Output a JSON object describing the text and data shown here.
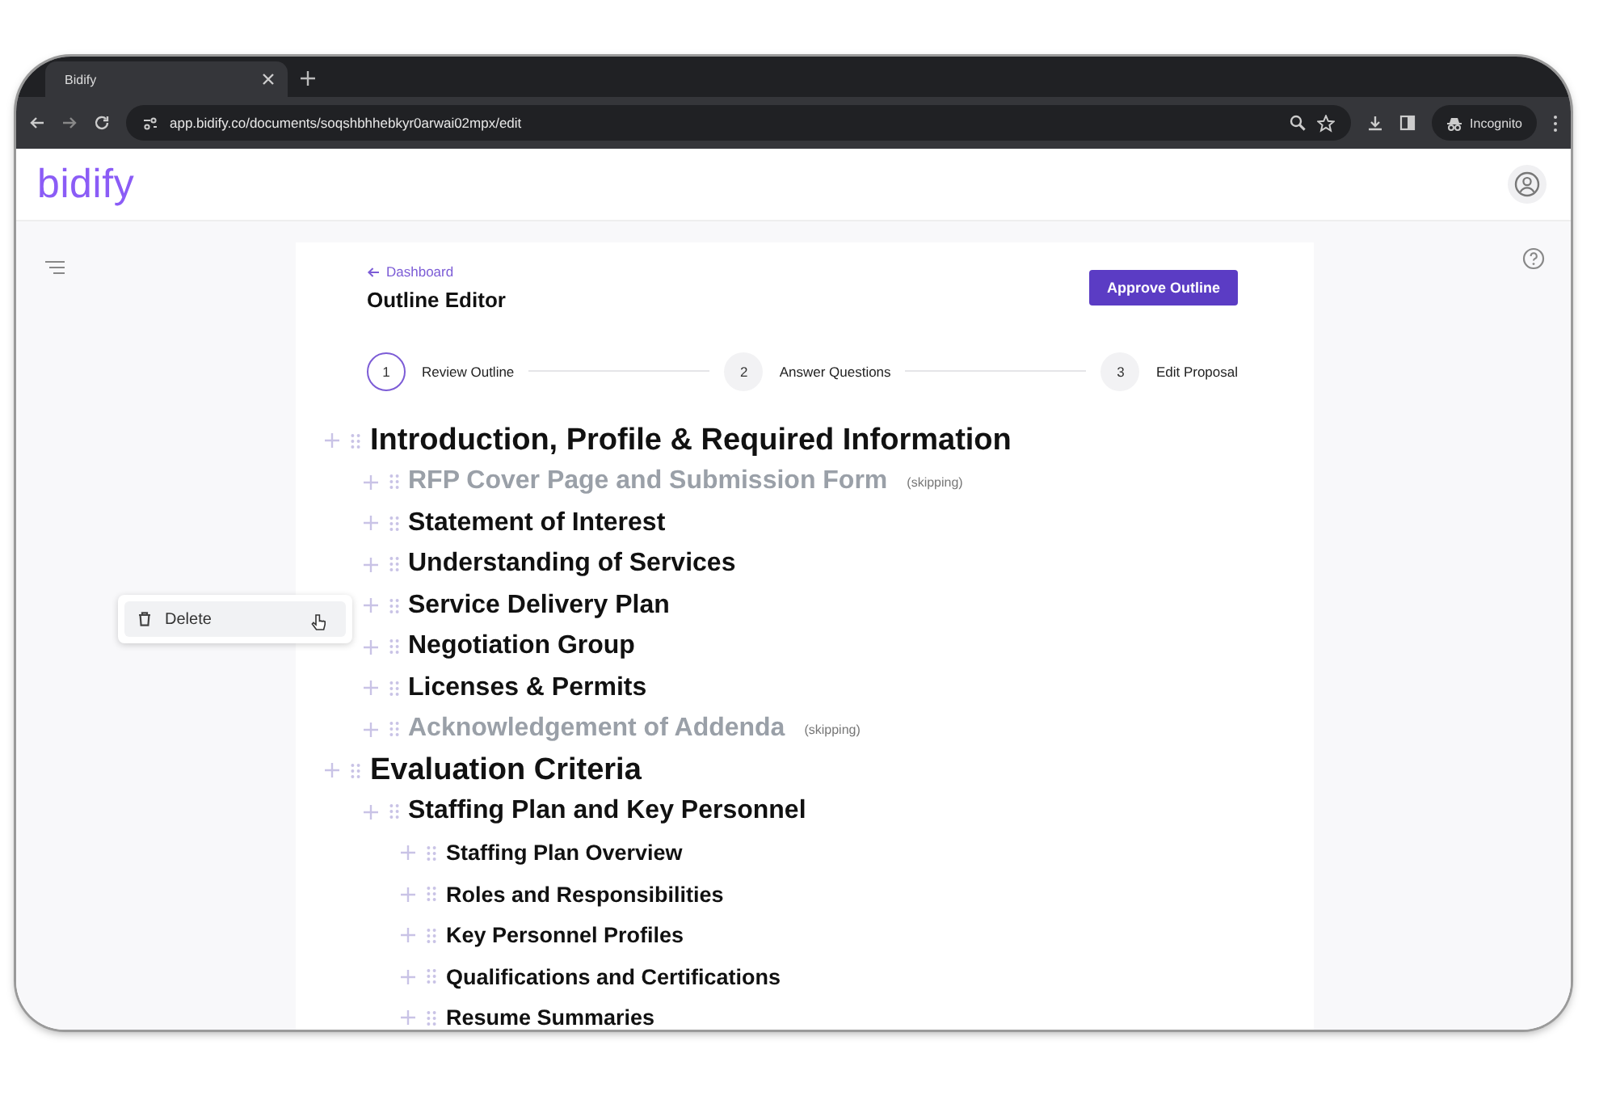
{
  "browser": {
    "tab_title": "Bidify",
    "url": "app.bidify.co/documents/soqshbhhebkyr0arwai02mpx/edit",
    "profile_label": "Incognito"
  },
  "app": {
    "logo": "bidify"
  },
  "editor": {
    "back_link": "Dashboard",
    "title": "Outline Editor",
    "approve_button": "Approve Outline",
    "steps": [
      {
        "number": "1",
        "label": "Review Outline",
        "selected": true
      },
      {
        "number": "2",
        "label": "Answer Questions",
        "selected": false
      },
      {
        "number": "3",
        "label": "Edit Proposal",
        "selected": false
      }
    ]
  },
  "outline": [
    {
      "title": "Introduction, Profile & Required Information",
      "skipped": false,
      "children": [
        {
          "title": "RFP Cover Page and Submission Form",
          "skipped": true,
          "note": "(skipping)"
        },
        {
          "title": "Statement of Interest",
          "skipped": false
        },
        {
          "title": "Understanding of Services",
          "skipped": false
        },
        {
          "title": "Service Delivery Plan",
          "skipped": false
        },
        {
          "title": "Negotiation Group",
          "skipped": false
        },
        {
          "title": "Licenses & Permits",
          "skipped": false
        },
        {
          "title": "Acknowledgement of Addenda",
          "skipped": true,
          "note": "(skipping)"
        }
      ]
    },
    {
      "title": "Evaluation Criteria",
      "skipped": false,
      "children": [
        {
          "title": "Staffing Plan and Key Personnel",
          "skipped": false,
          "children": [
            {
              "title": "Staffing Plan Overview",
              "skipped": false
            },
            {
              "title": "Roles and Responsibilities",
              "skipped": false
            },
            {
              "title": "Key Personnel Profiles",
              "skipped": false
            },
            {
              "title": "Qualifications and Certifications",
              "skipped": false
            },
            {
              "title": "Resume Summaries",
              "skipped": false
            }
          ]
        }
      ]
    }
  ],
  "context_menu": {
    "items": [
      {
        "label": "Delete",
        "kind": "delete"
      }
    ]
  }
}
